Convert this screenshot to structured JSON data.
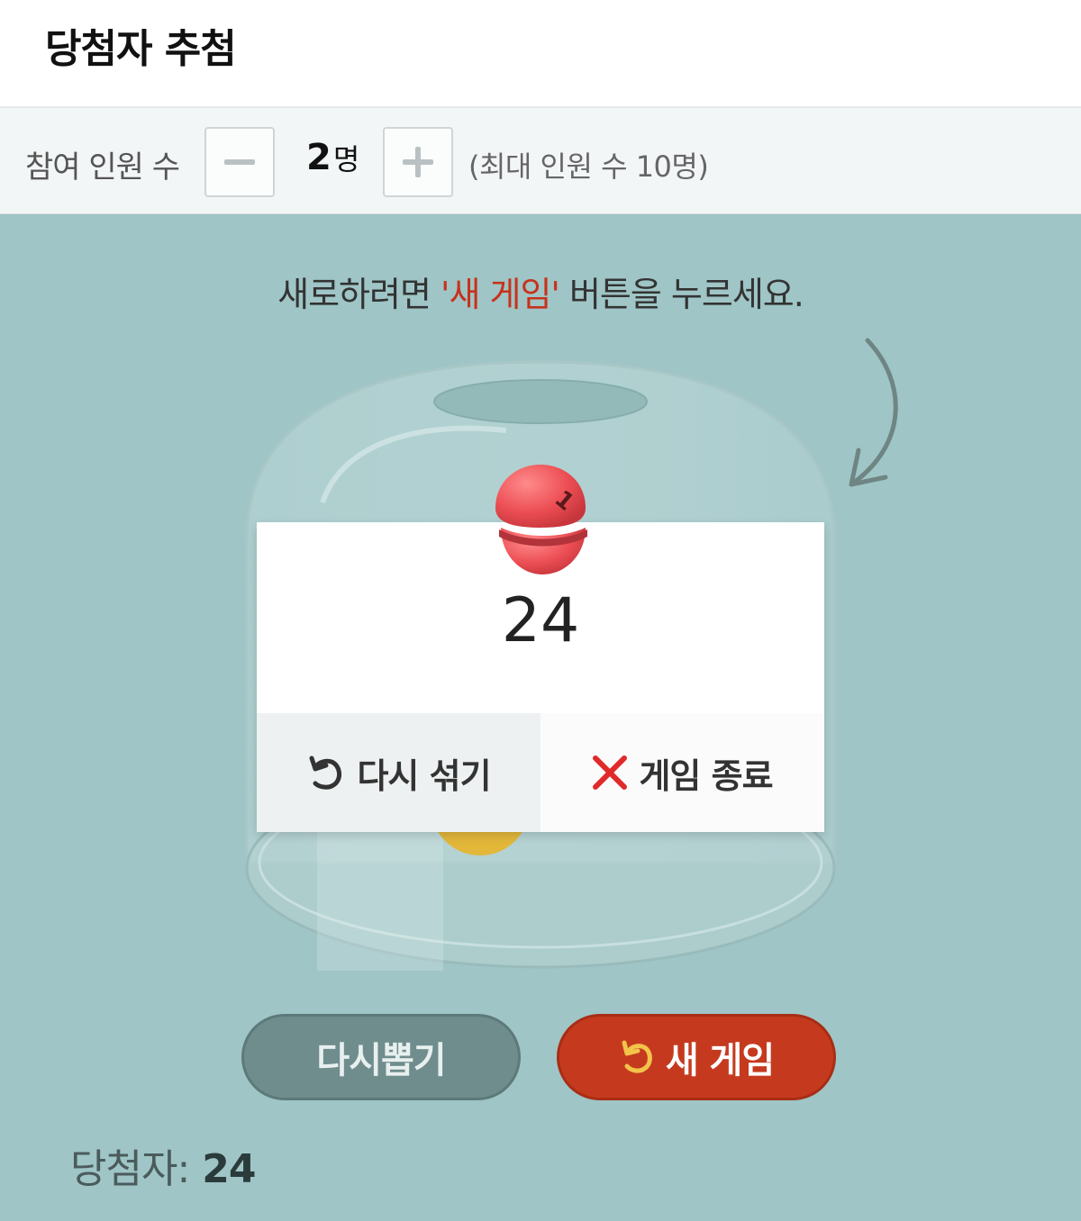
{
  "header": {
    "title": "당첨자 추첨"
  },
  "controls": {
    "label": "참여 인원 수",
    "minus_label": "−",
    "plus_label": "+",
    "count_value": "2",
    "count_unit": "명",
    "max_note": "(최대 인원 수 10명)"
  },
  "instruction": {
    "prefix": "새로하려면 ",
    "highlight": "'새 게임'",
    "suffix": " 버튼을 누르세요."
  },
  "result_card": {
    "ball_number": "1",
    "result": "24",
    "reshuffle_label": "다시 섞기",
    "end_label": "게임 종료"
  },
  "buttons": {
    "redraw": "다시뽑기",
    "newgame": "새 게임"
  },
  "winner": {
    "label": "당첨자:",
    "value": "24"
  },
  "colors": {
    "background": "#9fc5c6",
    "accent": "#c53a1e",
    "redraw_button": "#6f8d8d",
    "ball_red": "#e94a4f",
    "ball_yellow": "#e2b73a"
  }
}
